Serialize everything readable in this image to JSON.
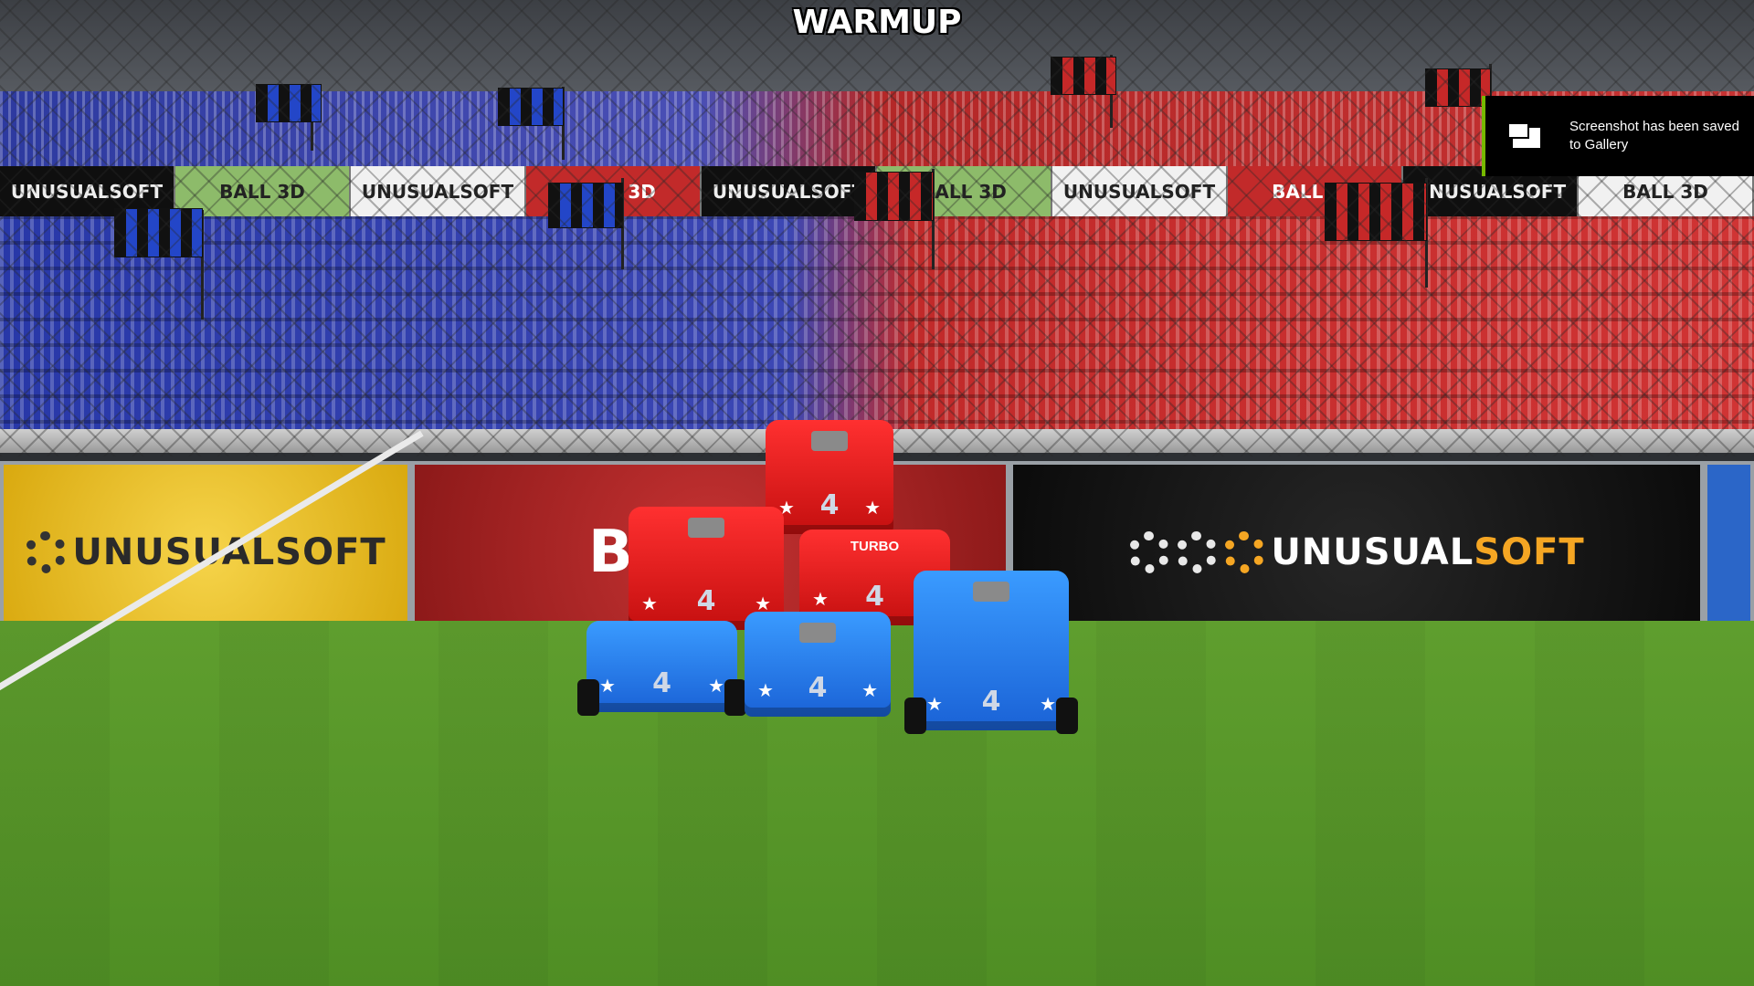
{
  "hud": {
    "mode_title": "WARMUP"
  },
  "notification": {
    "message": "Screenshot has been saved to Gallery",
    "icon": "gallery-icon",
    "accent_color": "#76b900"
  },
  "upper_banners": [
    "UNUSUALSOFT",
    "BALL 3D",
    "UNUSUALSOFT",
    "BALL 3D",
    "UNUSUALSOFT",
    "BALL 3D",
    "UNUSUALSOFT",
    "BALL 3D",
    "UNUSUALSOFT",
    "BALL 3D"
  ],
  "ad_boards": {
    "left": {
      "brand_a": "UNUSUAL",
      "brand_b": "SOFT"
    },
    "middle": {
      "text": "BALL"
    },
    "right": {
      "brand_a": "UNUSUAL",
      "brand_b": "SOFT"
    }
  },
  "cars": [
    {
      "team": "red",
      "number": "4",
      "label": ""
    },
    {
      "team": "red",
      "number": "4",
      "label": ""
    },
    {
      "team": "red",
      "number": "4",
      "label": "TURBO"
    },
    {
      "team": "blue",
      "number": "4",
      "label": ""
    },
    {
      "team": "blue",
      "number": "4",
      "label": ""
    },
    {
      "team": "blue",
      "number": "4",
      "label": ""
    }
  ],
  "colors": {
    "team_blue": "#1a62d6",
    "team_red": "#c40f0f",
    "field_green": "#5f9e2e"
  }
}
